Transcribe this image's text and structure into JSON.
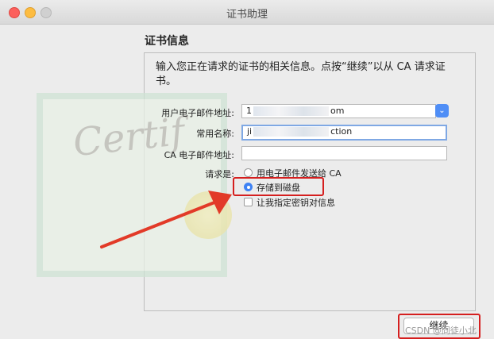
{
  "window": {
    "title": "证书助理"
  },
  "section": {
    "title": "证书信息"
  },
  "intro": "输入您正在请求的证书的相关信息。点按“继续”以从 CA 请求证书。",
  "form": {
    "email_label": "用户电子邮件地址:",
    "email_value_start": "1",
    "email_value_end": "om",
    "name_label": "常用名称:",
    "name_value_start": "ji",
    "name_value_end": "ction",
    "ca_email_label": "CA 电子邮件地址:",
    "ca_email_value": "",
    "request_label": "请求是:",
    "options": [
      "用电子邮件发送给 CA",
      "存储到磁盘"
    ],
    "selected_option": "存储到磁盘",
    "checkbox_label": "让我指定密钥对信息",
    "checkbox_checked": false
  },
  "buttons": {
    "continue": "继续"
  },
  "background_image": {
    "text": "Certif"
  },
  "watermark": "CSDN @同徒小北",
  "colors": {
    "accent": "#3f82f4",
    "highlight": "#d51f1f"
  }
}
